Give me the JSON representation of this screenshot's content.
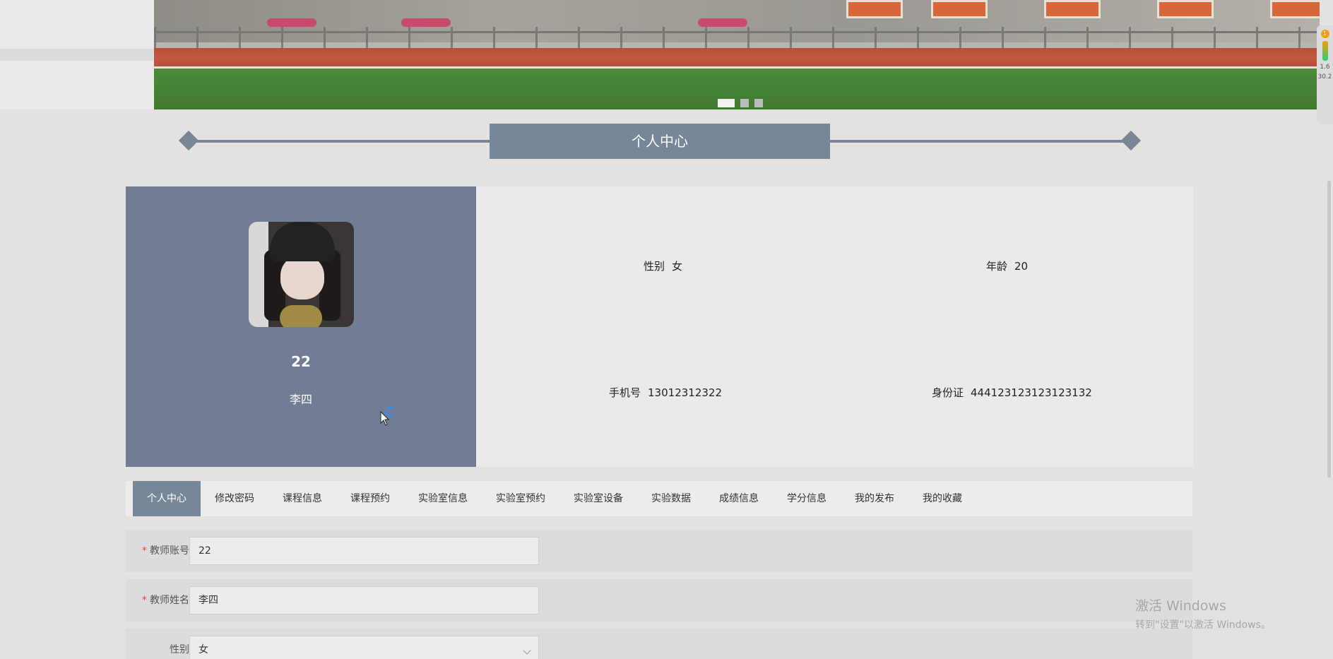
{
  "banner": {
    "slides": 3,
    "active_slide": 1
  },
  "right_widget": {
    "badge": "1",
    "line1": "1.6",
    "line2": "30.2"
  },
  "section": {
    "title": "个人中心"
  },
  "profile": {
    "account": "22",
    "name": "李四",
    "gender_label": "性别",
    "gender_value": "女",
    "age_label": "年龄",
    "age_value": "20",
    "phone_label": "手机号",
    "phone_value": "13012312322",
    "id_label": "身份证",
    "id_value": "444123123123123132"
  },
  "tabs": [
    {
      "label": "个人中心",
      "active": true
    },
    {
      "label": "修改密码"
    },
    {
      "label": "课程信息"
    },
    {
      "label": "课程预约"
    },
    {
      "label": "实验室信息"
    },
    {
      "label": "实验室预约"
    },
    {
      "label": "实验室设备"
    },
    {
      "label": "实验数据"
    },
    {
      "label": "成绩信息"
    },
    {
      "label": "学分信息"
    },
    {
      "label": "我的发布"
    },
    {
      "label": "我的收藏"
    }
  ],
  "form": {
    "account": {
      "required_mark": "*",
      "label": "教师账号",
      "value": "22"
    },
    "name": {
      "required_mark": "*",
      "label": "教师姓名",
      "value": "李四"
    },
    "gender": {
      "label": "性别",
      "value": "女"
    }
  },
  "watermark": {
    "title": "激活 Windows",
    "subtitle": "转到\"设置\"以激活 Windows。"
  },
  "colors": {
    "accent": "#77879a",
    "profile_panel": "#727c94",
    "required": "#e64242"
  }
}
